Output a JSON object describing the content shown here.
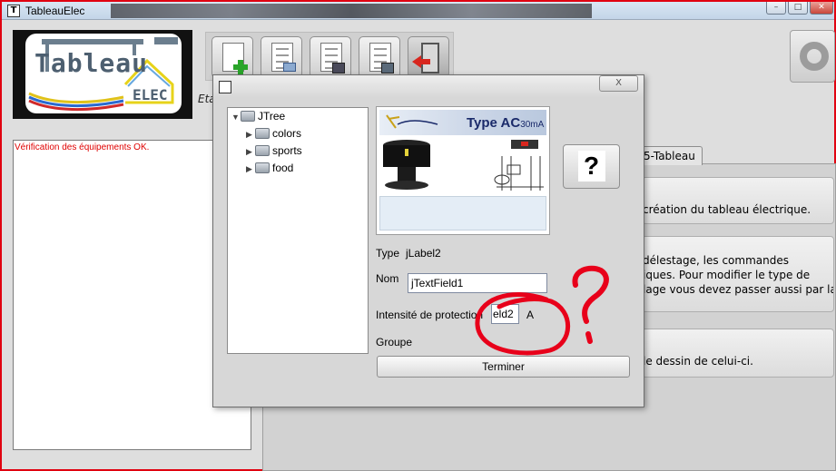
{
  "window": {
    "title": "TableauElec",
    "icon": "tableau-app-icon",
    "buttons": [
      "minimize",
      "maximize",
      "close"
    ]
  },
  "logo": {
    "text_main": "Tableau",
    "text_sub": "ELEC"
  },
  "toolbar": {
    "buttons": [
      "new-document-icon",
      "open-document-icon",
      "save-document-icon",
      "copy-document-icon",
      "exit-icon"
    ]
  },
  "status_label": "Eta",
  "log": {
    "message": "Vérification des équipements OK."
  },
  "right": {
    "tab_label": "5-Tableau",
    "cards": [
      {
        "lines": [
          "création du tableau électrique."
        ]
      },
      {
        "lines": [
          "délestage, les commandes",
          "iques. Pour modifier le type de",
          "lage vous devez passer aussi par la"
        ]
      },
      {
        "lines": [
          "le dessin de celui-ci."
        ]
      }
    ]
  },
  "dialog": {
    "close_label": "X",
    "tree": {
      "root": "JTree",
      "children": [
        "colors",
        "sports",
        "food"
      ]
    },
    "device": {
      "type_label": "Type AC",
      "rating": "30mA",
      "brand": ""
    },
    "help_label": "?",
    "type": {
      "label": "Type",
      "value": "jLabel2"
    },
    "nom": {
      "label": "Nom",
      "value": "jTextField1"
    },
    "intensite": {
      "label": "Intensité de protection",
      "value": "eld2",
      "unit": "A"
    },
    "groupe": {
      "label": "Groupe"
    },
    "submit_label": "Terminer"
  },
  "annotation": {
    "mark": "?",
    "color": "#e8001a"
  },
  "colors": {
    "frame_border": "#e00010",
    "log_text": "#e00000",
    "device_type_text": "#1a2a6a"
  }
}
